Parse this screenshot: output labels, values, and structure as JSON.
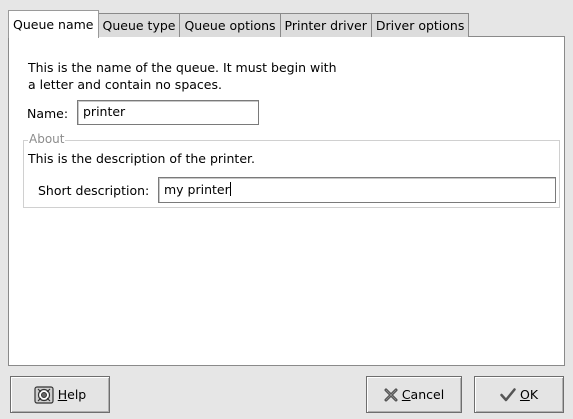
{
  "tabs": [
    {
      "label": "Queue name",
      "active": true
    },
    {
      "label": "Queue type",
      "active": false
    },
    {
      "label": "Queue options",
      "active": false
    },
    {
      "label": "Printer driver",
      "active": false
    },
    {
      "label": "Driver options",
      "active": false
    }
  ],
  "intro": {
    "line1": "This is the name of the queue.  It must begin with",
    "line2": "a letter and contain no spaces."
  },
  "name_field": {
    "label": "Name:",
    "value": "printer"
  },
  "about": {
    "legend": "About",
    "description": "This is the description of the printer.",
    "short_label": "Short description:",
    "short_value": "my printer"
  },
  "buttons": {
    "help": {
      "mnemonic": "H",
      "rest": "elp",
      "icon": "help-icon"
    },
    "cancel": {
      "mnemonic": "C",
      "rest": "ancel",
      "icon": "cancel-x-icon"
    },
    "ok": {
      "mnemonic": "O",
      "rest": "K",
      "icon": "checkmark-icon"
    }
  }
}
